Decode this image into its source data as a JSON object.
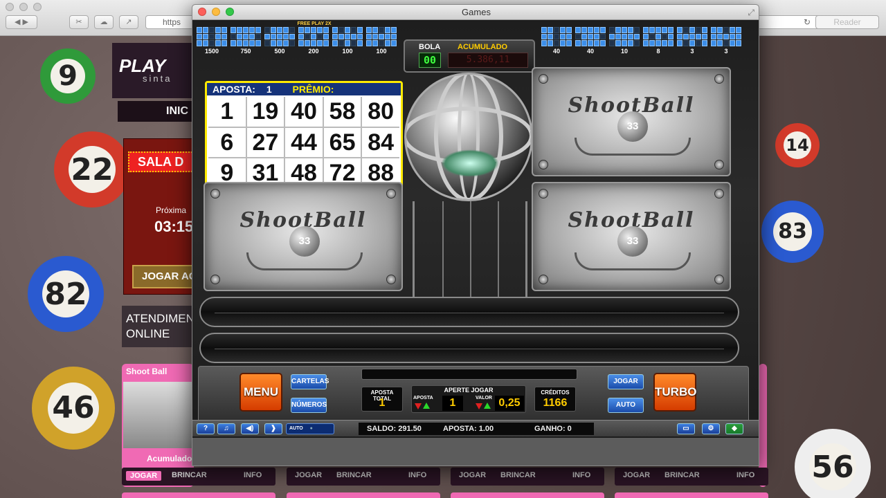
{
  "browser": {
    "url_prefix": "https",
    "reader_label": "Reader"
  },
  "site": {
    "logo_text": "PLAY",
    "logo_sub": "sinta",
    "nav_item": "INIC",
    "sala_label": "SALA D",
    "next_label": "Próxima",
    "next_time": "03:15",
    "play_label": "JOGAR AG",
    "support_line1": "ATENDIMEN",
    "support_line2": "ONLINE",
    "card_title": "Shoot Ball",
    "card_acumulado": "Acumulado",
    "card_buttons": [
      {
        "jogar": "JOGAR",
        "brincar": "BRINCAR",
        "info": "INFO"
      },
      {
        "jogar": "JOGAR",
        "brincar": "BRINCAR",
        "info": "INFO"
      },
      {
        "jogar": "JOGAR",
        "brincar": "BRINCAR",
        "info": "INFO"
      },
      {
        "jogar": "JOGAR",
        "brincar": "BRINCAR",
        "info": "INFO"
      }
    ]
  },
  "window": {
    "title": "Games"
  },
  "prize_patterns_left": [
    "1500",
    "750",
    "500",
    "200",
    "100",
    "100"
  ],
  "prize_patterns_right": [
    "40",
    "40",
    "10",
    "8",
    "3",
    "3"
  ],
  "free_play_label": "FREE PLAY 2X",
  "bola": {
    "label": "BOLA",
    "value": "00",
    "acumulado_label": "ACUMULADO",
    "acumulado_value": "5.386,11"
  },
  "cartela": {
    "aposta_label": "APOSTA:",
    "aposta_value": "1",
    "premio_label": "PRÊMIO:",
    "numbers": [
      "1",
      "19",
      "40",
      "58",
      "80",
      "6",
      "27",
      "44",
      "65",
      "84",
      "9",
      "31",
      "48",
      "72",
      "88"
    ]
  },
  "plates": {
    "logo_text": "ShootBall",
    "ball_number": "33"
  },
  "controls": {
    "menu": "MENU",
    "cartelas": "CARTELAS",
    "numeros": "NÚMEROS",
    "aposta_total_label": "APOSTA TOTAL",
    "aposta_total_value": "1",
    "aperte_jogar": "APERTE JOGAR",
    "aposta_label": "APOSTA",
    "aposta_value": "1",
    "valor_label": "VALOR",
    "valor_value": "0,25",
    "creditos_label": "CRÉDITOS",
    "creditos_value": "1166",
    "jogar": "JOGAR",
    "auto": "AUTO",
    "turbo": "TURBO"
  },
  "status": {
    "help": "?",
    "music": "♫",
    "sound": "🔊",
    "next": "❱",
    "auto_label": "AUTO",
    "saldo": "SALDO: 291.50",
    "aposta": "APOSTA: 1.00",
    "ganho": "GANHO: 0"
  }
}
